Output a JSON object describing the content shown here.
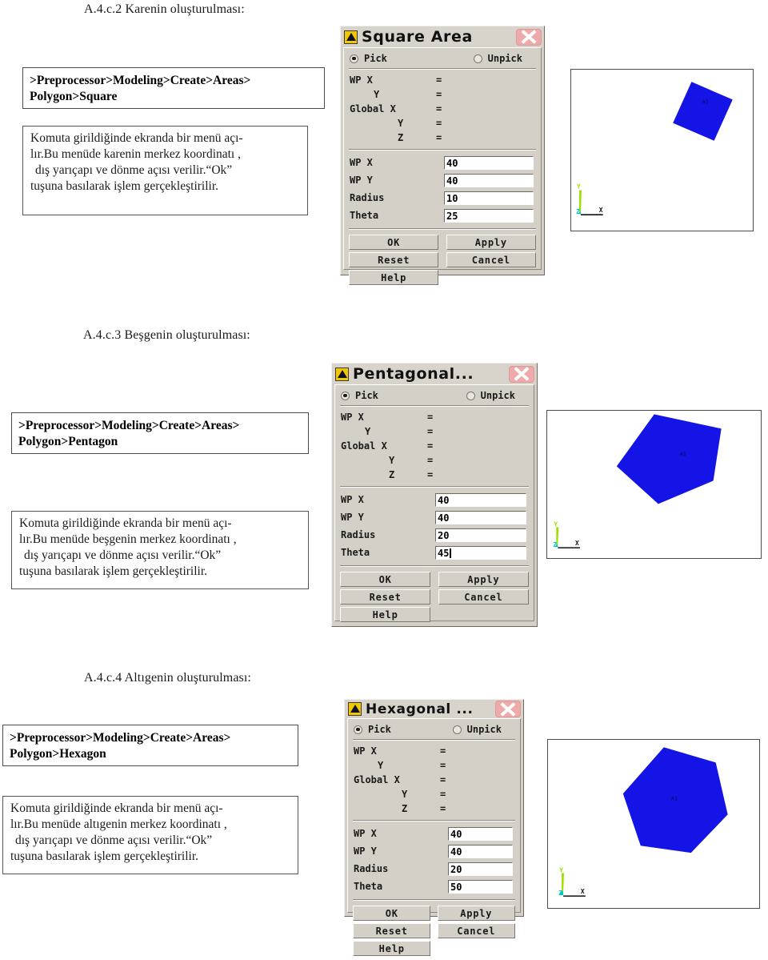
{
  "document": {
    "language": "tr",
    "colors": {
      "shape_fill": "#1414e6",
      "dialog_face": "#d4d0c8",
      "dialog_close": "#eeaaaa",
      "icon_gold": "#f0c800",
      "axis_y": "#9ce000",
      "axis_z": "#00c8c8",
      "area_label": "#0a0a5a"
    }
  },
  "sections": [
    {
      "id": "square",
      "heading": "A.4.c.2 Karenin oluşturulması:",
      "path_lines": [
        ">Preprocessor>Modeling>Create>Areas>",
        "Polygon>Square"
      ],
      "description_lines": [
        "Komuta girildiğinde ekranda bir menü açı-",
        "lır.Bu menüde karenin merkez koordinatı ,",
        " dış yarıçapı ve dönme açısı verilir.“Ok”",
        "tuşuna basılarak işlem gerçekleştirilir."
      ],
      "dialog": {
        "title": "Square Area",
        "icon": "ansys-logo-icon",
        "close_label": "close-icon",
        "pick_label": "Pick",
        "unpick_label": "Unpick",
        "pick_selected": true,
        "readonly_rows": [
          {
            "label": "WP X",
            "eq": "=",
            "value": "",
            "indent": 0
          },
          {
            "label": "Y",
            "eq": "=",
            "value": "",
            "indent": 1
          },
          {
            "label": "Global X",
            "eq": "=",
            "value": "",
            "indent": 0
          },
          {
            "label": "Y",
            "eq": "=",
            "value": "",
            "indent": 2
          },
          {
            "label": "Z",
            "eq": "=",
            "value": "",
            "indent": 2
          }
        ],
        "fields": [
          {
            "label": "WP X",
            "value": "40",
            "caret": false
          },
          {
            "label": "WP Y",
            "value": "40",
            "caret": false
          },
          {
            "label": "Radius",
            "value": "10",
            "caret": false
          },
          {
            "label": "Theta",
            "value": "25",
            "caret": false
          }
        ],
        "buttons": {
          "ok": "OK",
          "apply": "Apply",
          "reset": "Reset",
          "cancel": "Cancel",
          "help": "Help"
        }
      },
      "viewport": {
        "shape": "square",
        "area_label": "A1",
        "triad": {
          "y": "Y",
          "z": "Z",
          "x": "X"
        }
      }
    },
    {
      "id": "pentagon",
      "heading": "A.4.c.3 Beşgenin oluşturulması:",
      "path_lines": [
        ">Preprocessor>Modeling>Create>Areas>",
        "Polygon>Pentagon"
      ],
      "description_lines": [
        "Komuta girildiğinde ekranda bir menü açı-",
        "lır.Bu menüde beşgenin merkez koordinatı ,",
        " dış yarıçapı ve dönme açısı verilir.“Ok”",
        "tuşuna basılarak işlem gerçekleştirilir."
      ],
      "dialog": {
        "title": "Pentagonal...",
        "icon": "ansys-logo-icon",
        "close_label": "close-icon",
        "pick_label": "Pick",
        "unpick_label": "Unpick",
        "pick_selected": true,
        "readonly_rows": [
          {
            "label": "WP X",
            "eq": "=",
            "value": "",
            "indent": 0
          },
          {
            "label": "Y",
            "eq": "=",
            "value": "",
            "indent": 1
          },
          {
            "label": "Global X",
            "eq": "=",
            "value": "",
            "indent": 0
          },
          {
            "label": "Y",
            "eq": "=",
            "value": "",
            "indent": 2
          },
          {
            "label": "Z",
            "eq": "=",
            "value": "",
            "indent": 2
          }
        ],
        "fields": [
          {
            "label": "WP X",
            "value": "40",
            "caret": false
          },
          {
            "label": "WP Y",
            "value": "40",
            "caret": false
          },
          {
            "label": "Radius",
            "value": "20",
            "caret": false
          },
          {
            "label": "Theta",
            "value": "45",
            "caret": true
          }
        ],
        "buttons": {
          "ok": "OK",
          "apply": "Apply",
          "reset": "Reset",
          "cancel": "Cancel",
          "help": "Help"
        }
      },
      "viewport": {
        "shape": "pentagon",
        "area_label": "A1",
        "triad": {
          "y": "Y",
          "z": "Z",
          "x": "X"
        }
      }
    },
    {
      "id": "hexagon",
      "heading": "A.4.c.4 Altıgenin oluşturulması:",
      "path_lines": [
        ">Preprocessor>Modeling>Create>Areas>",
        "Polygon>Hexagon"
      ],
      "description_lines": [
        "Komuta girildiğinde ekranda bir menü açı-",
        "lır.Bu menüde altıgenin merkez koordinatı ,",
        " dış yarıçapı ve dönme açısı verilir.“Ok”",
        "tuşuna basılarak işlem gerçekleştirilir."
      ],
      "dialog": {
        "title": "Hexagonal ...",
        "icon": "ansys-logo-icon",
        "close_label": "close-icon",
        "pick_label": "Pick",
        "unpick_label": "Unpick",
        "pick_selected": true,
        "readonly_rows": [
          {
            "label": "WP X",
            "eq": "=",
            "value": "",
            "indent": 0
          },
          {
            "label": "Y",
            "eq": "=",
            "value": "",
            "indent": 1
          },
          {
            "label": "Global X",
            "eq": "=",
            "value": "",
            "indent": 0
          },
          {
            "label": "Y",
            "eq": "=",
            "value": "",
            "indent": 2
          },
          {
            "label": "Z",
            "eq": "=",
            "value": "",
            "indent": 2
          }
        ],
        "fields": [
          {
            "label": "WP X",
            "value": "40",
            "caret": false
          },
          {
            "label": "WP Y",
            "value": "40",
            "caret": false
          },
          {
            "label": "Radius",
            "value": "20",
            "caret": false
          },
          {
            "label": "Theta",
            "value": "50",
            "caret": false
          }
        ],
        "buttons": {
          "ok": "OK",
          "apply": "Apply",
          "reset": "Reset",
          "cancel": "Cancel",
          "help": "Help"
        }
      },
      "viewport": {
        "shape": "hexagon",
        "area_label": "A1",
        "triad": {
          "y": "Y",
          "z": "Z",
          "x": "X"
        }
      }
    }
  ]
}
